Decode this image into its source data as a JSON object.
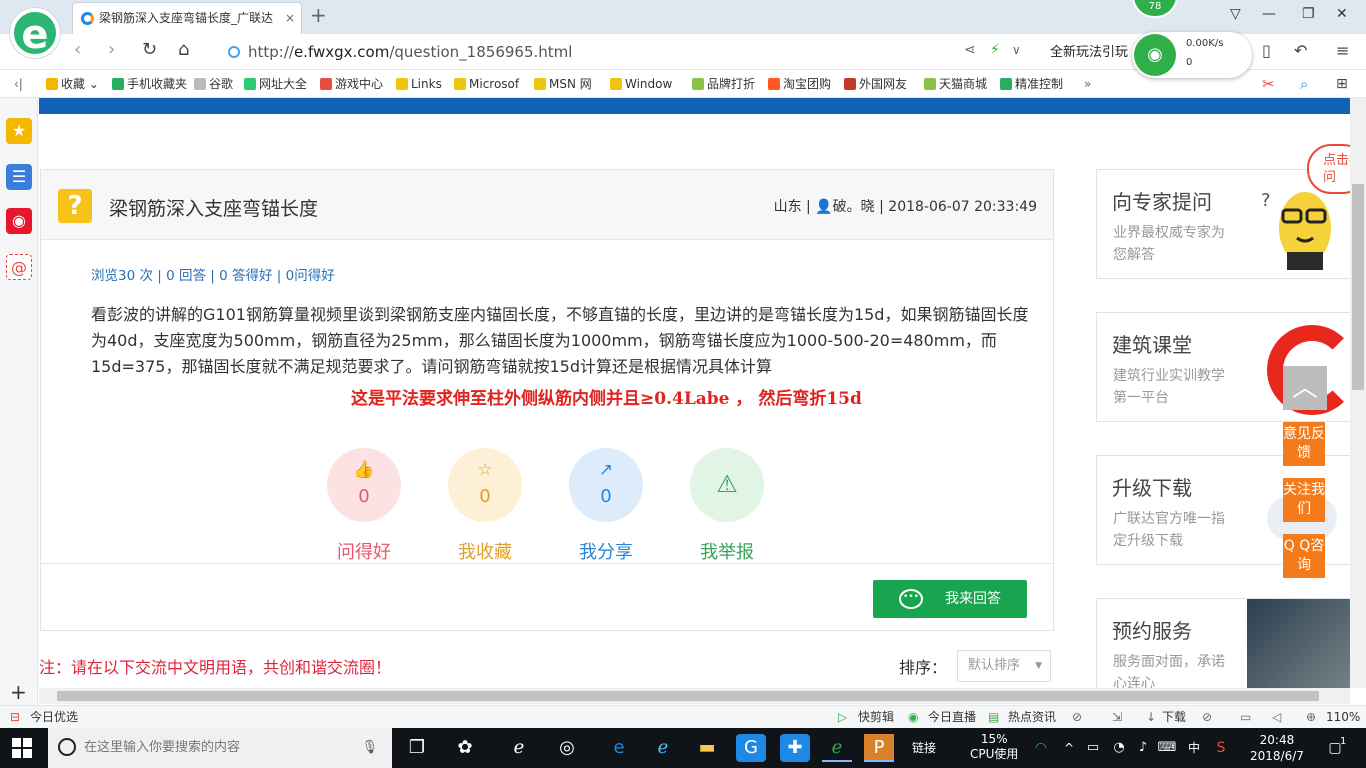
{
  "tab": {
    "title": "梁钢筋深入支座弯锚长度_广联达",
    "close": "×",
    "new": "+"
  },
  "badge": "78",
  "address": {
    "url_prefix": "http://",
    "url_domain": "e.fwxgx.com",
    "url_path": "/question_1856965.html"
  },
  "promo_text": "全新玩法引玩",
  "speed": {
    "upload": "0.00K/s",
    "download": "0"
  },
  "bookmarks": [
    {
      "label": "收藏",
      "color": "#f5b700"
    },
    {
      "label": "手机收藏夹",
      "color": "#27ae60"
    },
    {
      "label": "谷歌",
      "color": "#bbbbbb"
    },
    {
      "label": "网址大全",
      "color": "#2ecc71"
    },
    {
      "label": "游戏中心",
      "color": "#e74c3c"
    },
    {
      "label": "Links",
      "color": "#f1c40f"
    },
    {
      "label": "Microsof",
      "color": "#f1c40f"
    },
    {
      "label": "MSN 网",
      "color": "#f1c40f"
    },
    {
      "label": "Window",
      "color": "#f1c40f"
    },
    {
      "label": "品牌打折",
      "color": "#8bc34a"
    },
    {
      "label": "淘宝团购",
      "color": "#ff5722"
    },
    {
      "label": "外国网友",
      "color": "#c0392b"
    },
    {
      "label": "天猫商城",
      "color": "#8bc34a"
    },
    {
      "label": "精准控制",
      "color": "#27ae60"
    }
  ],
  "bookmarks_more": "»",
  "question": {
    "title": "梁钢筋深入支座弯锚长度",
    "location": "山东",
    "user": "破。晓",
    "datetime": "2018-06-07 20:33:49",
    "stats": "浏览30 次 | 0 回答 | 0 答得好 | 0问得好",
    "body": "看彭波的讲解的G101钢筋算量视频里谈到梁钢筋支座内锚固长度，不够直锚的长度，里边讲的是弯锚长度为15d，如果钢筋锚固长度为40d，支座宽度为500mm，钢筋直径为25mm，那么锚固长度为1000mm，钢筋弯锚长度应为1000-500-20=480mm，而15d=375，那锚固长度就不满足规范要求了。请问钢筋弯锚就按15d计算还是根据情况具体计算",
    "annotation": "这是平法要求伸至柱外侧纵筋内侧并且≥0.4Labe ， 然后弯折15d",
    "actions": [
      {
        "label": "问得好",
        "count": "0",
        "icon": "👍",
        "bg": "#fde2e4",
        "fg": "#e55a6a"
      },
      {
        "label": "我收藏",
        "count": "0",
        "icon": "☆",
        "bg": "#fdf0d6",
        "fg": "#e0a030"
      },
      {
        "label": "我分享",
        "count": "0",
        "icon": "↗",
        "bg": "#dcecfb",
        "fg": "#2a87d6"
      },
      {
        "label": "我举报",
        "count": "",
        "icon": "⚠",
        "bg": "#e0f5e6",
        "fg": "#3aa35b"
      }
    ],
    "answer_button": "我来回答"
  },
  "notice": "注：请在以下交流中文明用语，共创和谐交流圈！",
  "sort": {
    "label": "排序：",
    "value": "默认排序"
  },
  "right_cards": [
    {
      "title": "向专家提问",
      "desc": "业界最权威专家为您解答"
    },
    {
      "title": "建筑课堂",
      "desc": "建筑行业实训教学第一平台"
    },
    {
      "title": "升级下载",
      "desc": "广联达官方唯一指定升级下载"
    },
    {
      "title": "预约服务",
      "desc": "服务面对面，承诺心连心"
    }
  ],
  "float_ask": "点击提问",
  "float_buttons": [
    "意见反馈",
    "关注我们",
    "Q Q咨询"
  ],
  "statusbar": {
    "left": "今日优选",
    "items": [
      "快剪辑",
      "今日直播",
      "热点资讯",
      "下载"
    ],
    "zoom": "110%"
  },
  "taskbar": {
    "search_placeholder": "在这里输入你要搜索的内容",
    "link_label": "链接",
    "cpu_percent": "15%",
    "cpu_label": "CPU使用",
    "lang": "中",
    "time": "20:48",
    "date": "2018/6/7",
    "notify_count": "1"
  }
}
